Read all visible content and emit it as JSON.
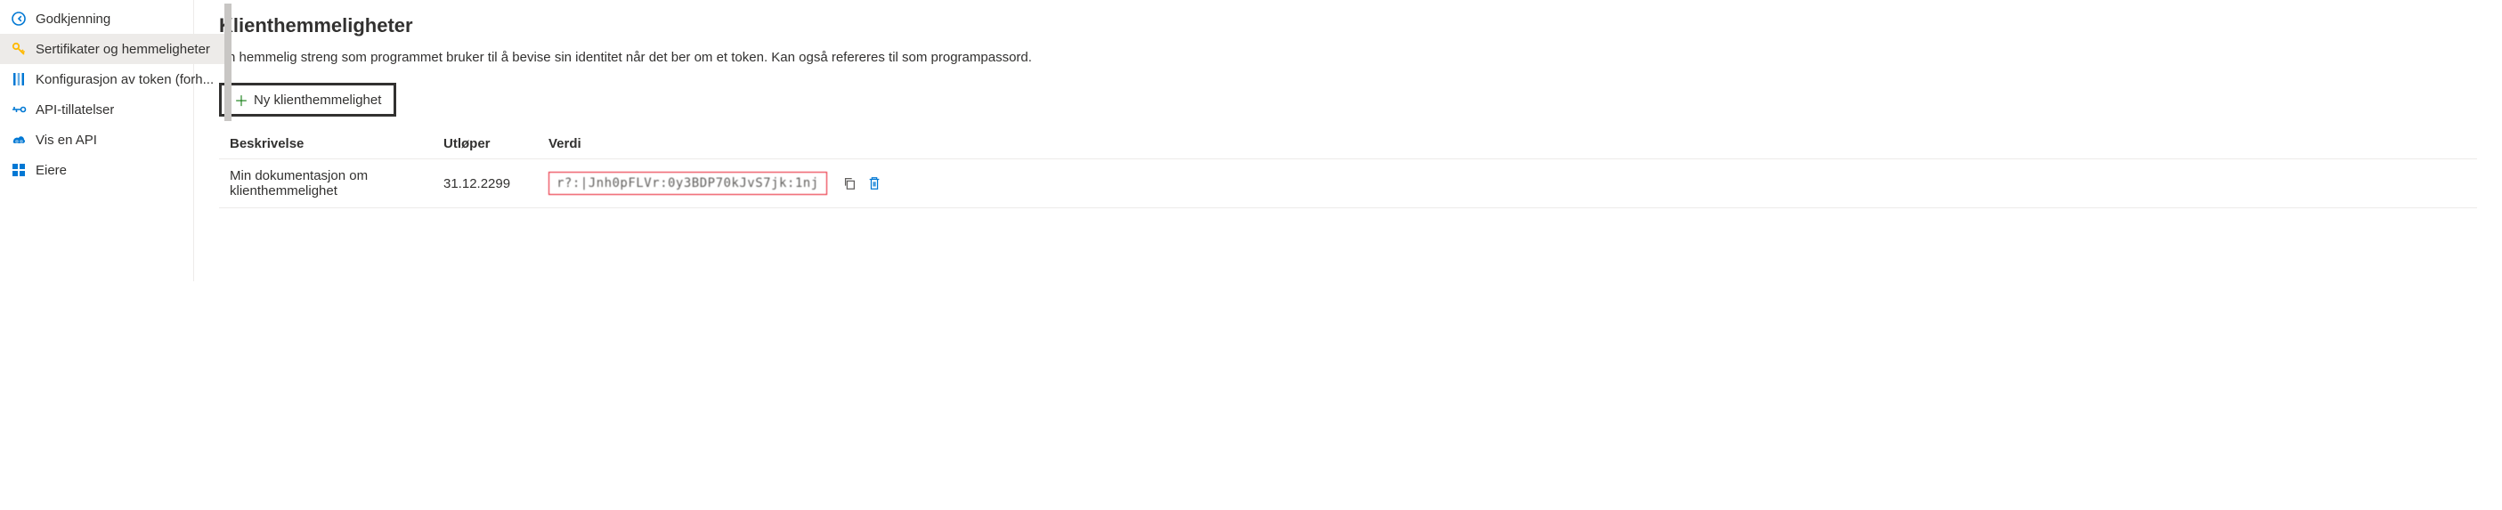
{
  "sidebar": {
    "items": [
      {
        "label": "Godkjenning",
        "icon": "auth"
      },
      {
        "label": "Sertifikater og hemmeligheter",
        "icon": "key",
        "selected": true
      },
      {
        "label": "Konfigurasjon av token (forh...",
        "icon": "token"
      },
      {
        "label": "API-tillatelser",
        "icon": "api-perm"
      },
      {
        "label": "Vis en API",
        "icon": "expose-api"
      },
      {
        "label": "Eiere",
        "icon": "owners"
      }
    ]
  },
  "main": {
    "title": "Klienthemmeligheter",
    "description": "En hemmelig streng som programmet bruker til å bevise sin identitet når det ber om et token. Kan også refereres til som programpassord.",
    "new_secret_label": "Ny klienthemmelighet",
    "table": {
      "headers": {
        "description": "Beskrivelse",
        "expires": "Utløper",
        "value": "Verdi"
      },
      "rows": [
        {
          "description": "Min dokumentasjon om klienthemmelighet",
          "expires": "31.12.2299",
          "value": "r?:|Jnh0pFLVr:0y3BDP70kJvS7jk:1nj"
        }
      ]
    }
  }
}
